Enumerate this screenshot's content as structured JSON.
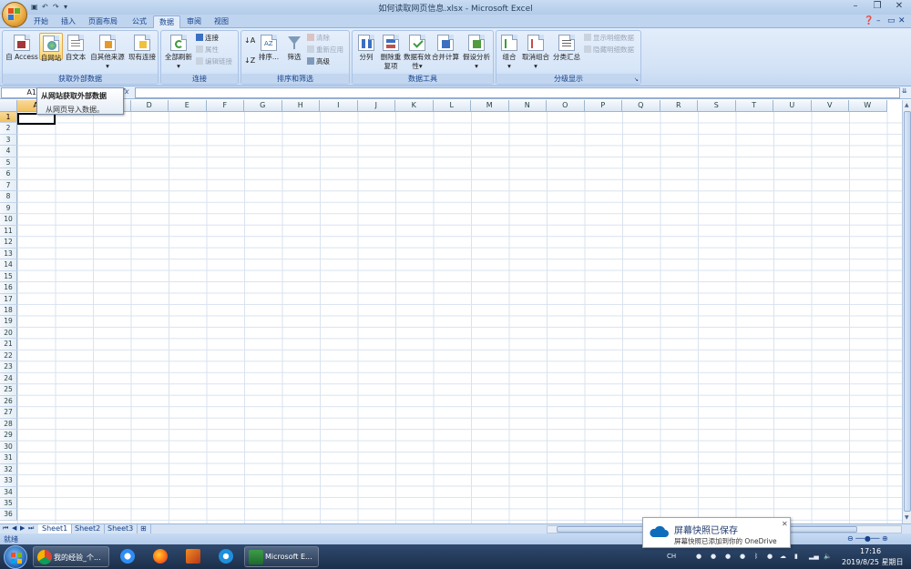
{
  "window": {
    "title": "如何读取网页信息.xlsx - Microsoft Excel",
    "minimize": "–",
    "restore": "❐",
    "close": "✕"
  },
  "ribbon_tabs": [
    "开始",
    "插入",
    "页面布局",
    "公式",
    "数据",
    "审阅",
    "视图"
  ],
  "active_tab": "数据",
  "groups": {
    "external": {
      "label": "获取外部数据",
      "buttons": [
        "自 Access",
        "自网站",
        "自文本",
        "自其他来源",
        "现有连接"
      ]
    },
    "connections": {
      "label": "连接",
      "refresh": "全部刷新",
      "items": [
        "连接",
        "属性",
        "编辑链接"
      ]
    },
    "sort": {
      "label": "排序和筛选",
      "sort_btn": "排序...",
      "filter_btn": "筛选",
      "items": [
        "清除",
        "重新应用",
        "高级"
      ]
    },
    "tools": {
      "label": "数据工具",
      "buttons": [
        "分列",
        "删除重复项",
        "数据有效性",
        "合并计算",
        "假设分析"
      ]
    },
    "outline": {
      "label": "分级显示",
      "buttons": [
        "组合",
        "取消组合",
        "分类汇总"
      ],
      "items": [
        "显示明细数据",
        "隐藏明细数据"
      ]
    }
  },
  "formula_bar": {
    "name_box": "A1",
    "fx": "fx"
  },
  "tooltip": {
    "title": "从网站获取外部数据",
    "body": "从网页导入数据。"
  },
  "columns": [
    "A",
    "B",
    "C",
    "D",
    "E",
    "F",
    "G",
    "H",
    "I",
    "J",
    "K",
    "L",
    "M",
    "N",
    "O",
    "P",
    "Q",
    "R",
    "S",
    "T",
    "U",
    "V",
    "W"
  ],
  "rows": [
    "1",
    "2",
    "3",
    "4",
    "5",
    "6",
    "7",
    "8",
    "9",
    "10",
    "11",
    "12",
    "13",
    "14",
    "15",
    "16",
    "17",
    "18",
    "19",
    "20",
    "21",
    "22",
    "23",
    "24",
    "25",
    "26",
    "27",
    "28",
    "29",
    "30",
    "31",
    "32",
    "33",
    "34",
    "35",
    "36"
  ],
  "sheets": [
    "Sheet1",
    "Sheet2",
    "Sheet3"
  ],
  "active_sheet": "Sheet1",
  "status": {
    "ready": "就绪"
  },
  "taskbar": {
    "items": [
      {
        "label": "我的经验_个...",
        "icon": "chrome-icon"
      },
      {
        "label": "",
        "icon": "baidu-netdisk-icon"
      },
      {
        "label": "",
        "icon": "firefox-icon"
      },
      {
        "label": "",
        "icon": "matlab-icon"
      },
      {
        "label": "",
        "icon": "ie-icon"
      },
      {
        "label": "Microsoft E...",
        "icon": "excel-icon"
      }
    ],
    "clock_time": "17:16",
    "clock_date": "2019/8/25 星期日"
  },
  "toast": {
    "title": "屏幕快照已保存",
    "body": "屏幕快照已添加到你的 OneDrive"
  },
  "colors": {
    "accent": "#15428b",
    "highlight": "#ffd671",
    "onedrive": "#0f6cbd"
  }
}
